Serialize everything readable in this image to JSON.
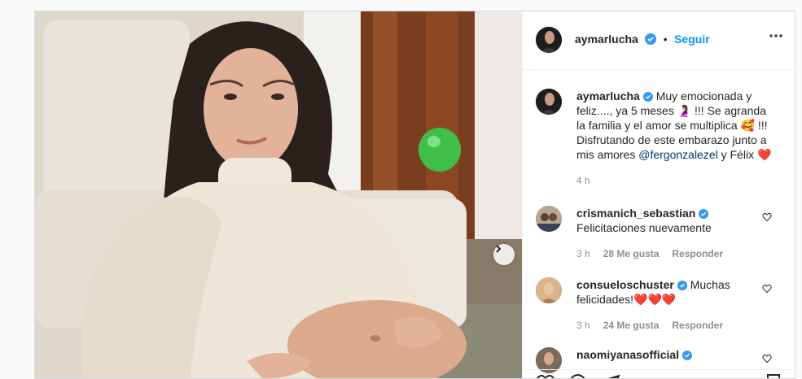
{
  "post": {
    "author": "aymarlucha",
    "follow_label": "Seguir",
    "caption_text": "Muy emocionada y feliz...., ya 5 meses 🤰 !!! Se agranda la familia y el amor se multiplica 🥰 !!! Disfrutando de este embarazo junto a mis amores",
    "caption_mention": "@fergonzalezel",
    "caption_tail": "y Félix ❤️",
    "caption_time": "4 h"
  },
  "comments": [
    {
      "user": "crismanich_sebastian",
      "text": "Felicitaciones nuevamente",
      "time": "3 h",
      "likes": "28 Me gusta",
      "reply": "Responder"
    },
    {
      "user": "consueloschuster",
      "text": "Muchas felicidades!❤️❤️❤️",
      "time": "3 h",
      "likes": "24 Me gusta",
      "reply": "Responder"
    },
    {
      "user": "naomiyanasofficial",
      "text": "",
      "time": "",
      "likes": "",
      "reply": ""
    }
  ],
  "colors": {
    "accent": "#0095f6",
    "verified": "#3897f0",
    "text": "#262626",
    "muted": "#8e8e8e"
  },
  "icons": [
    "verified-badge-icon",
    "more-options-icon",
    "next-arrow-icon",
    "heart-icon",
    "comment-icon",
    "share-icon",
    "save-icon"
  ]
}
